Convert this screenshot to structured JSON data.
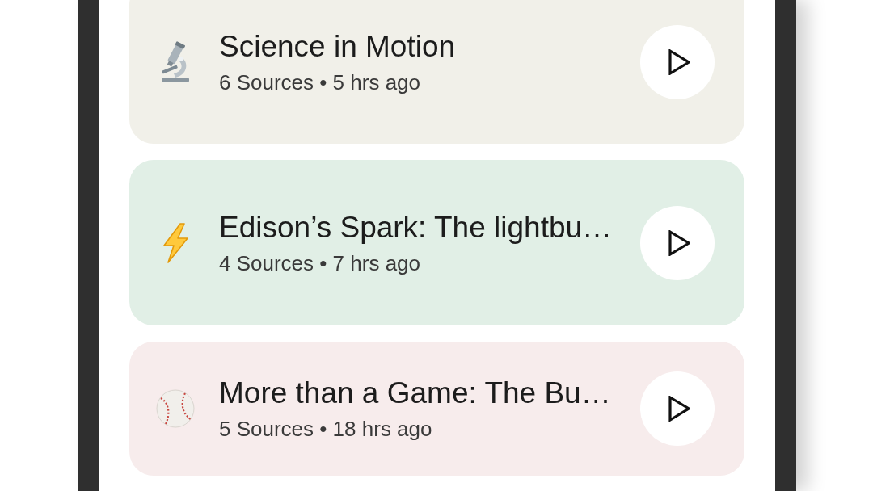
{
  "episodes": [
    {
      "kind": "microscope",
      "title": "Science in Motion",
      "details": "6 Sources • 5 hrs ago",
      "color": "#f1f0e9"
    },
    {
      "kind": "lightning",
      "title": "Edison’s Spark: The lightbu…",
      "details": "4 Sources • 7 hrs ago",
      "color": "#e1efe6"
    },
    {
      "kind": "baseball",
      "title": "More than a Game: The Bu…",
      "details": "5 Sources • 18 hrs ago",
      "color": "#f7ecec"
    }
  ]
}
